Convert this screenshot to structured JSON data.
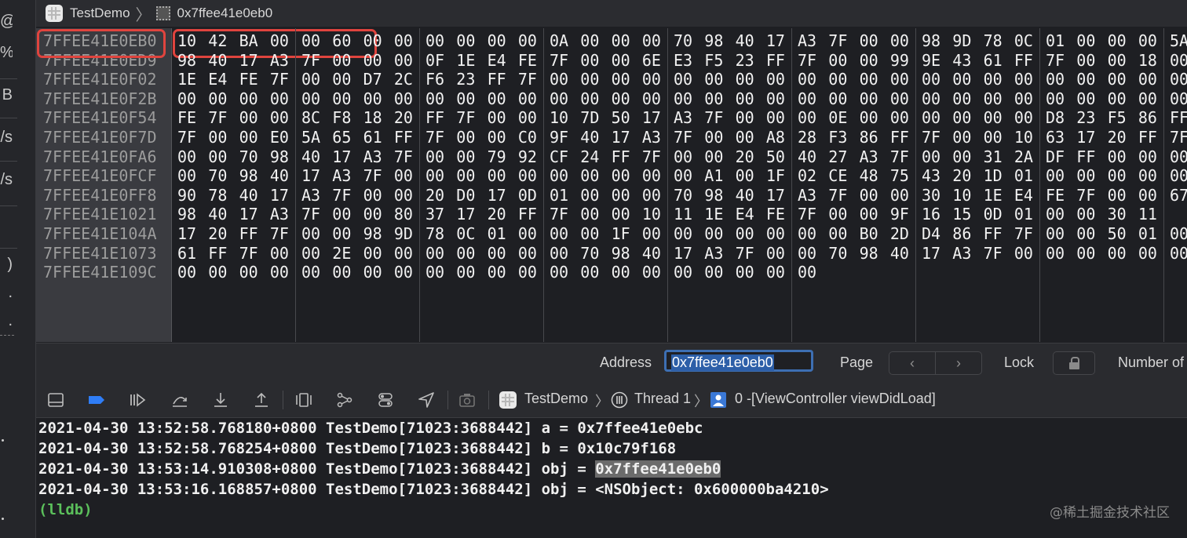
{
  "titlebar": {
    "app": "TestDemo",
    "memory_address": "0x7ffee41e0eb0"
  },
  "gutter": {
    "glyphs": [
      "@",
      "%",
      "B",
      "/s",
      "/s",
      ")",
      ".",
      "."
    ]
  },
  "memory": {
    "addresses": [
      "7FFEE41E0EB0",
      "7FFEE41E0ED9",
      "7FFEE41E0F02",
      "7FFEE41E0F2B",
      "7FFEE41E0F54",
      "7FFEE41E0F7D",
      "7FFEE41E0FA6",
      "7FFEE41E0FCF",
      "7FFEE41E0FF8",
      "7FFEE41E1021",
      "7FFEE41E104A",
      "7FFEE41E1073",
      "7FFEE41E109C"
    ],
    "rows": [
      [
        "10",
        "42",
        "BA",
        "00",
        "00",
        "60",
        "00",
        "00",
        "00",
        "00",
        "00",
        "00",
        "0A",
        "00",
        "00",
        "00",
        "70",
        "98",
        "40",
        "17",
        "A3",
        "7F",
        "00",
        "00",
        "98",
        "9D",
        "78",
        "0C",
        "01",
        "00",
        "00",
        "00",
        "5A"
      ],
      [
        "98",
        "40",
        "17",
        "A3",
        "7F",
        "00",
        "00",
        "00",
        "0F",
        "1E",
        "E4",
        "FE",
        "7F",
        "00",
        "00",
        "6E",
        "E3",
        "F5",
        "23",
        "FF",
        "7F",
        "00",
        "00",
        "99",
        "9E",
        "43",
        "61",
        "FF",
        "7F",
        "00",
        "00",
        "18",
        "00"
      ],
      [
        "1E",
        "E4",
        "FE",
        "7F",
        "00",
        "00",
        "D7",
        "2C",
        "F6",
        "23",
        "FF",
        "7F",
        "00",
        "00",
        "00",
        "00",
        "00",
        "00",
        "00",
        "00",
        "00",
        "00",
        "00",
        "00",
        "00",
        "00",
        "00",
        "00",
        "00",
        "00",
        "00",
        "00",
        "00"
      ],
      [
        "00",
        "00",
        "00",
        "00",
        "00",
        "00",
        "00",
        "00",
        "00",
        "00",
        "00",
        "00",
        "00",
        "00",
        "00",
        "00",
        "00",
        "00",
        "00",
        "00",
        "00",
        "00",
        "00",
        "00",
        "00",
        "00",
        "00",
        "00",
        "00",
        "00",
        "00",
        "00",
        "00"
      ],
      [
        "FE",
        "7F",
        "00",
        "00",
        "8C",
        "F8",
        "18",
        "20",
        "FF",
        "7F",
        "00",
        "00",
        "10",
        "7D",
        "50",
        "17",
        "A3",
        "7F",
        "00",
        "00",
        "00",
        "0E",
        "00",
        "00",
        "00",
        "00",
        "00",
        "00",
        "D8",
        "23",
        "F5",
        "86",
        "FF"
      ],
      [
        "7F",
        "00",
        "00",
        "E0",
        "5A",
        "65",
        "61",
        "FF",
        "7F",
        "00",
        "00",
        "C0",
        "9F",
        "40",
        "17",
        "A3",
        "7F",
        "00",
        "00",
        "A8",
        "28",
        "F3",
        "86",
        "FF",
        "7F",
        "00",
        "00",
        "10",
        "63",
        "17",
        "20",
        "FF",
        "7F"
      ],
      [
        "00",
        "00",
        "70",
        "98",
        "40",
        "17",
        "A3",
        "7F",
        "00",
        "00",
        "79",
        "92",
        "CF",
        "24",
        "FF",
        "7F",
        "00",
        "00",
        "20",
        "50",
        "40",
        "27",
        "A3",
        "7F",
        "00",
        "00",
        "31",
        "2A",
        "DF",
        "FF",
        "00",
        "00",
        "00"
      ],
      [
        "00",
        "70",
        "98",
        "40",
        "17",
        "A3",
        "7F",
        "00",
        "00",
        "00",
        "00",
        "00",
        "00",
        "00",
        "00",
        "00",
        "00",
        "A1",
        "00",
        "1F",
        "02",
        "CE",
        "48",
        "75",
        "43",
        "20",
        "1D",
        "01",
        "00",
        "00",
        "00",
        "00",
        "00"
      ],
      [
        "90",
        "78",
        "40",
        "17",
        "A3",
        "7F",
        "00",
        "00",
        "20",
        "D0",
        "17",
        "0D",
        "01",
        "00",
        "00",
        "00",
        "70",
        "98",
        "40",
        "17",
        "A3",
        "7F",
        "00",
        "00",
        "30",
        "10",
        "1E",
        "E4",
        "FE",
        "7F",
        "00",
        "00",
        "67"
      ],
      [
        "98",
        "40",
        "17",
        "A3",
        "7F",
        "00",
        "00",
        "80",
        "37",
        "17",
        "20",
        "FF",
        "7F",
        "00",
        "00",
        "10",
        "11",
        "1E",
        "E4",
        "FE",
        "7F",
        "00",
        "00",
        "9F",
        "16",
        "15",
        "0D",
        "01",
        "00",
        "00",
        "30",
        "11"
      ],
      [
        "17",
        "20",
        "FF",
        "7F",
        "00",
        "00",
        "98",
        "9D",
        "78",
        "0C",
        "01",
        "00",
        "00",
        "00",
        "1F",
        "00",
        "00",
        "00",
        "00",
        "00",
        "00",
        "00",
        "B0",
        "2D",
        "D4",
        "86",
        "FF",
        "7F",
        "00",
        "00",
        "50",
        "01",
        "00"
      ],
      [
        "61",
        "FF",
        "7F",
        "00",
        "00",
        "2E",
        "00",
        "00",
        "00",
        "00",
        "00",
        "00",
        "00",
        "70",
        "98",
        "40",
        "17",
        "A3",
        "7F",
        "00",
        "00",
        "70",
        "98",
        "40",
        "17",
        "A3",
        "7F",
        "00",
        "00",
        "00",
        "00",
        "00",
        "00"
      ],
      [
        "00",
        "00",
        "00",
        "00",
        "00",
        "00",
        "00",
        "00",
        "00",
        "00",
        "00",
        "00",
        "00",
        "00",
        "00",
        "00",
        "00",
        "00",
        "00",
        "00",
        "00"
      ]
    ]
  },
  "addressbar": {
    "address_label": "Address",
    "address_value": "0x7ffee41e0eb0",
    "page_label": "Page",
    "page_prev": "‹",
    "page_next": "›",
    "lock_label": "Lock",
    "number_label": "Number of"
  },
  "debugbar": {
    "app": "TestDemo",
    "thread": "Thread 1",
    "frame": "0 -[ViewController viewDidLoad]",
    "icons": [
      "hide-console-icon",
      "breakpoints-icon",
      "continue-icon",
      "step-over-icon",
      "step-into-icon",
      "step-out-icon",
      "view-hierarchy-icon",
      "memory-graph-icon",
      "environment-icon",
      "location-icon",
      "camera-icon"
    ]
  },
  "console": {
    "lines": [
      {
        "prefix": "2021-04-30 13:52:58.768180+0800 TestDemo[71023:3688442] a = 0x7ffee41e0ebc",
        "selected": ""
      },
      {
        "prefix": "2021-04-30 13:52:58.768254+0800 TestDemo[71023:3688442] b = 0x10c79f168",
        "selected": ""
      },
      {
        "prefix": "2021-04-30 13:53:14.910308+0800 TestDemo[71023:3688442] obj = ",
        "selected": "0x7ffee41e0eb0"
      },
      {
        "prefix": "2021-04-30 13:53:16.168857+0800 TestDemo[71023:3688442] obj = <NSObject: 0x600000ba4210>",
        "selected": ""
      }
    ],
    "prompt": "(lldb)",
    "watermark": "@稀土掘金技术社区"
  },
  "colors": {
    "highlight": "#e0443e",
    "accent": "#3d6fb3",
    "prompt": "#5bbf5b"
  }
}
